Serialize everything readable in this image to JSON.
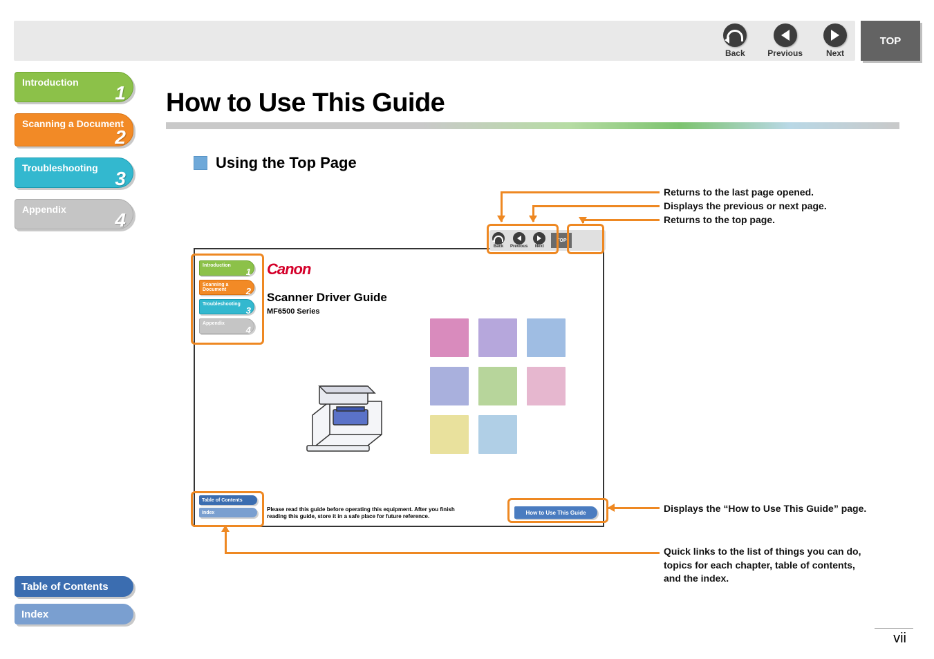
{
  "nav": {
    "back": "Back",
    "previous": "Previous",
    "next": "Next",
    "top": "TOP"
  },
  "tabs": {
    "intro": {
      "label": "Introduction",
      "num": "1"
    },
    "scan": {
      "label": "Scanning a Document",
      "num": "2"
    },
    "trouble": {
      "label": "Troubleshooting",
      "num": "3"
    },
    "appendix": {
      "label": "Appendix",
      "num": "4"
    }
  },
  "bottom": {
    "toc": "Table of Contents",
    "index": "Index"
  },
  "main": {
    "title": "How to Use This Guide",
    "section": "Using the Top Page"
  },
  "callouts": {
    "c1": "Returns to the last page opened.",
    "c2": "Displays the previous or next page.",
    "c3": "Returns to the top page.",
    "c4": "Displays the “How to Use This Guide” page.",
    "c5": "Quick links to the list of things you can do, topics for each chapter, table of contents, and the index."
  },
  "mini": {
    "brand": "Canon",
    "title": "Scanner Driver Guide",
    "series": "MF6500 Series",
    "note": "Please read this guide before operating this equipment. After you finish reading this guide, store it in a safe place for future reference.",
    "howto": "How to Use This Guide",
    "toc": "Table of Contents",
    "index": "Index",
    "top": "TOP",
    "back": "Back",
    "previous": "Previous",
    "next": "Next",
    "tabs": {
      "intro": {
        "label": "Introduction",
        "num": "1"
      },
      "scan": {
        "label": "Scanning a Document",
        "num": "2"
      },
      "trouble": {
        "label": "Troubleshooting",
        "num": "3"
      },
      "appendix": {
        "label": "Appendix",
        "num": "4"
      }
    },
    "swatches": [
      "#d98bbd",
      "#b6a7dc",
      "#9fbde3",
      "#a9b0dd",
      "#b7d59b",
      "#e6b7cf",
      "#e9e19d",
      "#b0cfe6",
      ""
    ]
  },
  "pagenum": "vii"
}
